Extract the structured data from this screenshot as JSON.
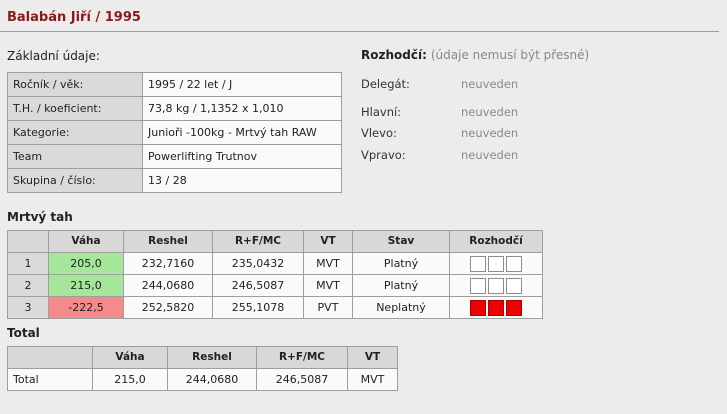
{
  "title": "Balabán Jiří / 1995",
  "basic": {
    "heading": "Základní údaje:",
    "rows": [
      {
        "label": "Ročník / věk:",
        "value": "1995 / 22 let / J"
      },
      {
        "label": "T.H. / koeficient:",
        "value": "73,8 kg / 1,1352 x 1,010"
      },
      {
        "label": "Kategorie:",
        "value": "Junioři -100kg - Mrtvý tah RAW"
      },
      {
        "label": "Team",
        "value": "Powerlifting Trutnov"
      },
      {
        "label": "Skupina / číslo:",
        "value": "13 / 28"
      }
    ]
  },
  "referees": {
    "heading": "Rozhodčí:",
    "note": "(údaje nemusí být přesné)",
    "delegate": {
      "label": "Delegát:",
      "value": "neuveden"
    },
    "items": [
      {
        "label": "Hlavní:",
        "value": "neuveden"
      },
      {
        "label": "Vlevo:",
        "value": "neuveden"
      },
      {
        "label": "Vpravo:",
        "value": "neuveden"
      }
    ]
  },
  "attempts": {
    "heading": "Mrtvý tah",
    "headers": [
      "",
      "Váha",
      "Reshel",
      "R+F/MC",
      "VT",
      "Stav",
      "Rozhodčí"
    ],
    "rows": [
      {
        "num": "1",
        "weight": "205,0",
        "reshel": "232,7160",
        "rfmc": "235,0432",
        "vt": "MVT",
        "status": "Platný",
        "weight_color": "#a5e69a",
        "lights": [
          "white",
          "white",
          "white"
        ]
      },
      {
        "num": "2",
        "weight": "215,0",
        "reshel": "244,0680",
        "rfmc": "246,5087",
        "vt": "MVT",
        "status": "Platný",
        "weight_color": "#a5e69a",
        "lights": [
          "white",
          "white",
          "white"
        ]
      },
      {
        "num": "3",
        "weight": "-222,5",
        "reshel": "252,5820",
        "rfmc": "255,1078",
        "vt": "PVT",
        "status": "Neplatný",
        "weight_color": "#f58a8a",
        "lights": [
          "red",
          "red",
          "red"
        ]
      }
    ]
  },
  "total": {
    "heading": "Total",
    "headers": [
      "",
      "Váha",
      "Reshel",
      "R+F/MC",
      "VT"
    ],
    "row": {
      "label": "Total",
      "weight": "215,0",
      "reshel": "244,0680",
      "rfmc": "246,5087",
      "vt": "MVT"
    }
  }
}
